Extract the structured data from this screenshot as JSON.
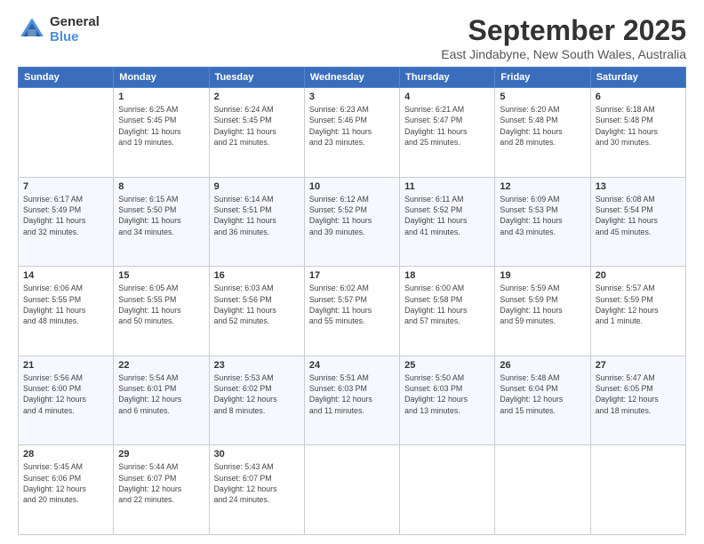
{
  "header": {
    "logo_line1": "General",
    "logo_line2": "Blue",
    "title": "September 2025",
    "subtitle": "East Jindabyne, New South Wales, Australia"
  },
  "weekdays": [
    "Sunday",
    "Monday",
    "Tuesday",
    "Wednesday",
    "Thursday",
    "Friday",
    "Saturday"
  ],
  "weeks": [
    [
      {
        "day": "",
        "info": ""
      },
      {
        "day": "1",
        "info": "Sunrise: 6:25 AM\nSunset: 5:45 PM\nDaylight: 11 hours\nand 19 minutes."
      },
      {
        "day": "2",
        "info": "Sunrise: 6:24 AM\nSunset: 5:45 PM\nDaylight: 11 hours\nand 21 minutes."
      },
      {
        "day": "3",
        "info": "Sunrise: 6:23 AM\nSunset: 5:46 PM\nDaylight: 11 hours\nand 23 minutes."
      },
      {
        "day": "4",
        "info": "Sunrise: 6:21 AM\nSunset: 5:47 PM\nDaylight: 11 hours\nand 25 minutes."
      },
      {
        "day": "5",
        "info": "Sunrise: 6:20 AM\nSunset: 5:48 PM\nDaylight: 11 hours\nand 28 minutes."
      },
      {
        "day": "6",
        "info": "Sunrise: 6:18 AM\nSunset: 5:48 PM\nDaylight: 11 hours\nand 30 minutes."
      }
    ],
    [
      {
        "day": "7",
        "info": "Sunrise: 6:17 AM\nSunset: 5:49 PM\nDaylight: 11 hours\nand 32 minutes."
      },
      {
        "day": "8",
        "info": "Sunrise: 6:15 AM\nSunset: 5:50 PM\nDaylight: 11 hours\nand 34 minutes."
      },
      {
        "day": "9",
        "info": "Sunrise: 6:14 AM\nSunset: 5:51 PM\nDaylight: 11 hours\nand 36 minutes."
      },
      {
        "day": "10",
        "info": "Sunrise: 6:12 AM\nSunset: 5:52 PM\nDaylight: 11 hours\nand 39 minutes."
      },
      {
        "day": "11",
        "info": "Sunrise: 6:11 AM\nSunset: 5:52 PM\nDaylight: 11 hours\nand 41 minutes."
      },
      {
        "day": "12",
        "info": "Sunrise: 6:09 AM\nSunset: 5:53 PM\nDaylight: 11 hours\nand 43 minutes."
      },
      {
        "day": "13",
        "info": "Sunrise: 6:08 AM\nSunset: 5:54 PM\nDaylight: 11 hours\nand 45 minutes."
      }
    ],
    [
      {
        "day": "14",
        "info": "Sunrise: 6:06 AM\nSunset: 5:55 PM\nDaylight: 11 hours\nand 48 minutes."
      },
      {
        "day": "15",
        "info": "Sunrise: 6:05 AM\nSunset: 5:55 PM\nDaylight: 11 hours\nand 50 minutes."
      },
      {
        "day": "16",
        "info": "Sunrise: 6:03 AM\nSunset: 5:56 PM\nDaylight: 11 hours\nand 52 minutes."
      },
      {
        "day": "17",
        "info": "Sunrise: 6:02 AM\nSunset: 5:57 PM\nDaylight: 11 hours\nand 55 minutes."
      },
      {
        "day": "18",
        "info": "Sunrise: 6:00 AM\nSunset: 5:58 PM\nDaylight: 11 hours\nand 57 minutes."
      },
      {
        "day": "19",
        "info": "Sunrise: 5:59 AM\nSunset: 5:59 PM\nDaylight: 11 hours\nand 59 minutes."
      },
      {
        "day": "20",
        "info": "Sunrise: 5:57 AM\nSunset: 5:59 PM\nDaylight: 12 hours\nand 1 minute."
      }
    ],
    [
      {
        "day": "21",
        "info": "Sunrise: 5:56 AM\nSunset: 6:00 PM\nDaylight: 12 hours\nand 4 minutes."
      },
      {
        "day": "22",
        "info": "Sunrise: 5:54 AM\nSunset: 6:01 PM\nDaylight: 12 hours\nand 6 minutes."
      },
      {
        "day": "23",
        "info": "Sunrise: 5:53 AM\nSunset: 6:02 PM\nDaylight: 12 hours\nand 8 minutes."
      },
      {
        "day": "24",
        "info": "Sunrise: 5:51 AM\nSunset: 6:03 PM\nDaylight: 12 hours\nand 11 minutes."
      },
      {
        "day": "25",
        "info": "Sunrise: 5:50 AM\nSunset: 6:03 PM\nDaylight: 12 hours\nand 13 minutes."
      },
      {
        "day": "26",
        "info": "Sunrise: 5:48 AM\nSunset: 6:04 PM\nDaylight: 12 hours\nand 15 minutes."
      },
      {
        "day": "27",
        "info": "Sunrise: 5:47 AM\nSunset: 6:05 PM\nDaylight: 12 hours\nand 18 minutes."
      }
    ],
    [
      {
        "day": "28",
        "info": "Sunrise: 5:45 AM\nSunset: 6:06 PM\nDaylight: 12 hours\nand 20 minutes."
      },
      {
        "day": "29",
        "info": "Sunrise: 5:44 AM\nSunset: 6:07 PM\nDaylight: 12 hours\nand 22 minutes."
      },
      {
        "day": "30",
        "info": "Sunrise: 5:43 AM\nSunset: 6:07 PM\nDaylight: 12 hours\nand 24 minutes."
      },
      {
        "day": "",
        "info": ""
      },
      {
        "day": "",
        "info": ""
      },
      {
        "day": "",
        "info": ""
      },
      {
        "day": "",
        "info": ""
      }
    ]
  ]
}
